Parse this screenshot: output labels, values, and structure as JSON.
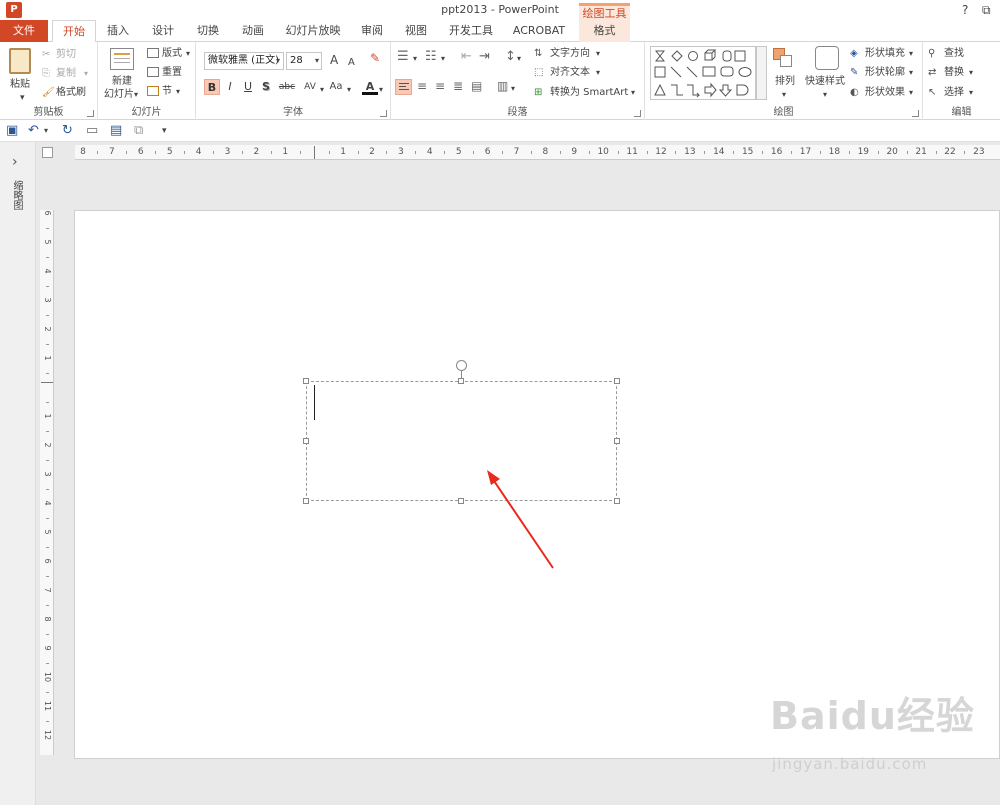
{
  "window": {
    "title": "ppt2013 - PowerPoint",
    "help": "?",
    "restore": "⧉"
  },
  "app_logo": "P",
  "tabs": [
    "文件",
    "开始",
    "插入",
    "设计",
    "切换",
    "动画",
    "幻灯片放映",
    "审阅",
    "视图",
    "开发工具",
    "ACROBAT",
    "格式"
  ],
  "context_label": "绘图工具",
  "clipboard": {
    "paste": "粘贴",
    "cut": "剪切",
    "copy": "复制",
    "format_painter": "格式刷",
    "label": "剪贴板"
  },
  "slides": {
    "new_slide": "新建",
    "new_slide2": "幻灯片",
    "layout": "版式",
    "reset": "重置",
    "section": "节",
    "label": "幻灯片"
  },
  "font": {
    "family": "微软雅黑 (正文)",
    "size": "28",
    "grow": "A",
    "shrink": "A",
    "clear": "✎",
    "bold": "B",
    "italic": "I",
    "underline": "U",
    "shadow": "S",
    "strike": "abc",
    "spacing": "AV",
    "case": "Aa",
    "color": "A",
    "label": "字体"
  },
  "paragraph": {
    "text_direction": "文字方向",
    "align_text": "对齐文本",
    "convert_smartart": "转换为 SmartArt",
    "label": "段落"
  },
  "drawing": {
    "arrange": "排列",
    "quick_styles": "快速样式",
    "shape_fill": "形状填充",
    "shape_outline": "形状轮廓",
    "shape_effects": "形状效果",
    "label": "绘图"
  },
  "editing": {
    "find": "查找",
    "replace": "替换",
    "select": "选择",
    "label": "编辑"
  },
  "left_pane": {
    "expand": "›",
    "label": "缩略图"
  },
  "h_ruler": [
    "8",
    "7",
    "6",
    "5",
    "4",
    "3",
    "2",
    "1",
    "",
    "1",
    "2",
    "3",
    "4",
    "5",
    "6",
    "7",
    "8",
    "9",
    "10",
    "11",
    "12",
    "13",
    "14",
    "15",
    "16",
    "17",
    "18",
    "19",
    "20",
    "21",
    "22",
    "23"
  ],
  "v_ruler": [
    "6",
    "5",
    "4",
    "3",
    "2",
    "1",
    "",
    "1",
    "2",
    "3",
    "4",
    "5",
    "6",
    "7",
    "8",
    "9",
    "10",
    "11",
    "12"
  ],
  "watermark": {
    "brand": "Baidu经验",
    "url": "jingyan.baidu.com"
  },
  "colors": {
    "accent": "#d24726",
    "arrow": "#e8291c"
  }
}
